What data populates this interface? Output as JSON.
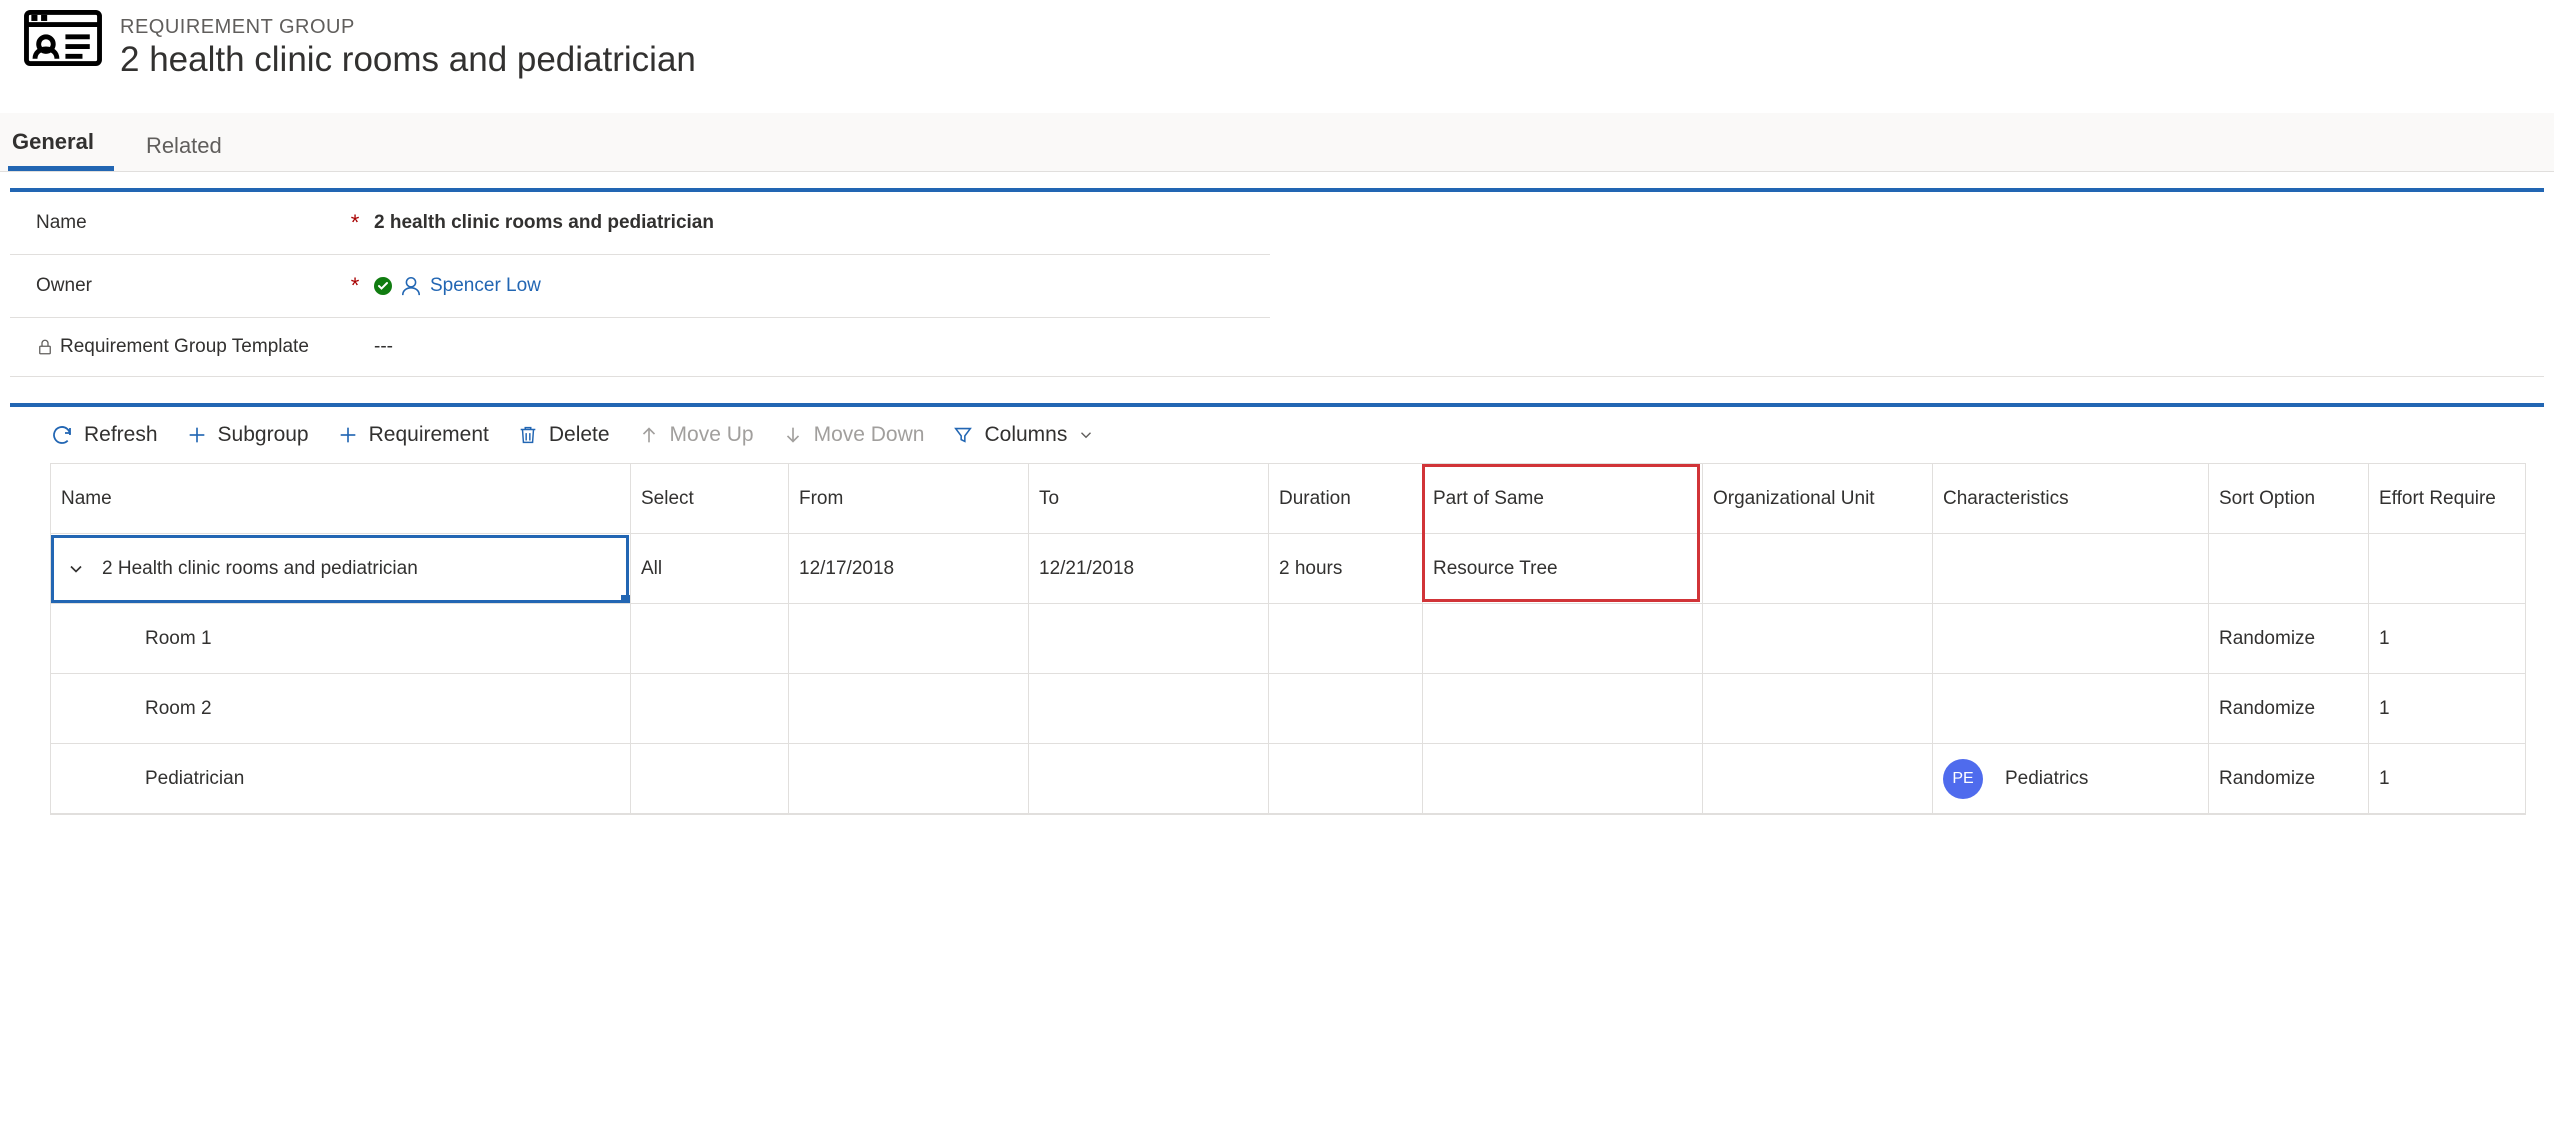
{
  "header": {
    "entity_label": "REQUIREMENT GROUP",
    "title": "2 health clinic rooms and pediatrician"
  },
  "tabs": [
    {
      "label": "General",
      "active": true
    },
    {
      "label": "Related",
      "active": false
    }
  ],
  "form": {
    "name_label": "Name",
    "name_value": "2 health clinic rooms and pediatrician",
    "owner_label": "Owner",
    "owner_value": "Spencer Low",
    "template_label": "Requirement Group Template",
    "template_value": "---"
  },
  "toolbar": {
    "refresh": "Refresh",
    "subgroup": "Subgroup",
    "requirement": "Requirement",
    "delete": "Delete",
    "moveup": "Move Up",
    "movedown": "Move Down",
    "columns": "Columns"
  },
  "grid": {
    "headers": {
      "name": "Name",
      "select": "Select",
      "from": "From",
      "to": "To",
      "duration": "Duration",
      "partofsame": "Part of Same",
      "orgunit": "Organizational Unit",
      "characteristics": "Characteristics",
      "sort": "Sort Option",
      "effort": "Effort Require"
    },
    "rows": [
      {
        "name": "2 Health clinic rooms and pediatrician",
        "level": "root",
        "select": "All",
        "from": "12/17/2018",
        "to": "12/21/2018",
        "duration": "2 hours",
        "partofsame": "Resource Tree",
        "orgunit": "",
        "characteristics": "",
        "char_badge": "",
        "sort": "",
        "effort": "",
        "selected": true
      },
      {
        "name": "Room 1",
        "level": "child",
        "select": "",
        "from": "",
        "to": "",
        "duration": "",
        "partofsame": "",
        "orgunit": "",
        "characteristics": "",
        "char_badge": "",
        "sort": "Randomize",
        "effort": "1"
      },
      {
        "name": "Room 2",
        "level": "child",
        "select": "",
        "from": "",
        "to": "",
        "duration": "",
        "partofsame": "",
        "orgunit": "",
        "characteristics": "",
        "char_badge": "",
        "sort": "Randomize",
        "effort": "1"
      },
      {
        "name": "Pediatrician",
        "level": "child",
        "select": "",
        "from": "",
        "to": "",
        "duration": "",
        "partofsame": "",
        "orgunit": "",
        "characteristics": "Pediatrics",
        "char_badge": "PE",
        "sort": "Randomize",
        "effort": "1"
      }
    ]
  }
}
